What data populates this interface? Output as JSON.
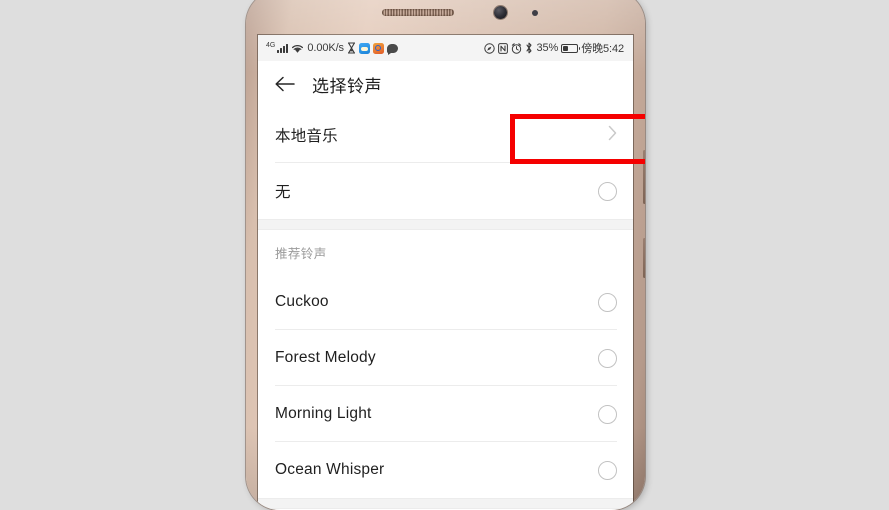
{
  "status_bar": {
    "network_type": "4G",
    "data_rate": "0.00K/s",
    "signal_icon": "signal-bars-icon",
    "wifi_icon": "wifi-icon",
    "hourglass_icon": "hourglass-icon",
    "weather_app_icon": "weather-app-icon",
    "orange_app_icon": "app-icon",
    "message_icon": "message-bubble-icon",
    "location_icon": "location-icon",
    "nfc_icon": "nfc-icon",
    "alarm_icon": "alarm-clock-icon",
    "bluetooth_icon": "bluetooth-icon",
    "battery_percent": "35%",
    "battery_level": 35,
    "battery_icon": "battery-icon",
    "time": "傍晚5:42"
  },
  "title_bar": {
    "back_icon": "back-arrow-icon",
    "title": "选择铃声"
  },
  "list": {
    "local_music": {
      "label": "本地音乐",
      "chevron": "›"
    },
    "none_option": {
      "label": "无",
      "selected": false
    },
    "section_header": "推荐铃声",
    "ringtones": [
      {
        "label": "Cuckoo",
        "selected": false
      },
      {
        "label": "Forest Melody",
        "selected": false
      },
      {
        "label": "Morning Light",
        "selected": false
      },
      {
        "label": "Ocean Whisper",
        "selected": false
      }
    ]
  },
  "annotation": {
    "highlight_color": "#f50000",
    "highlight_target": "本地音乐"
  },
  "device": {
    "body_color": "#d8bfae",
    "screen_background": "#ffffff",
    "page_background": "#dedede"
  }
}
